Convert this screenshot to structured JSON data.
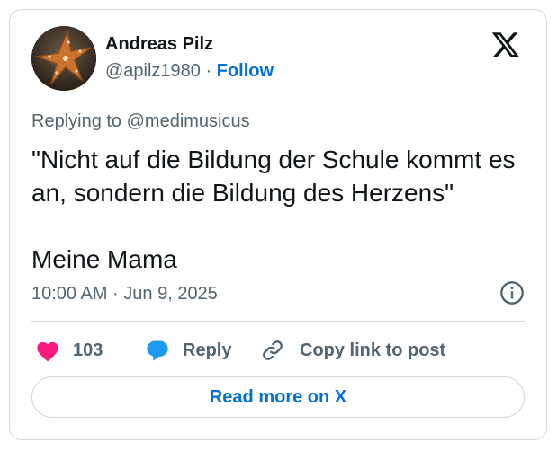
{
  "author": {
    "display_name": "Andreas Pilz",
    "handle": "@apilz1980",
    "separator": "·",
    "follow_label": "Follow",
    "avatar_icon": "starfish-avatar"
  },
  "platform_icon": "x-logo-icon",
  "tweet": {
    "reply_to": "Replying to @medimusicus",
    "text": "\"Nicht auf die Bildung der Schule kommt es an, sondern die Bildung des Herzens\"\n\nMeine Mama",
    "timestamp": "10:00 AM · Jun 9, 2025"
  },
  "actions": {
    "like_count": "103",
    "reply_label": "Reply",
    "copy_label": "Copy link to post"
  },
  "read_more_label": "Read more on X",
  "colors": {
    "link_blue": "#006fd6",
    "like_pink": "#f91880",
    "reply_blue": "#1d9bf0",
    "muted_text": "#536471",
    "border": "#cfd9de"
  }
}
